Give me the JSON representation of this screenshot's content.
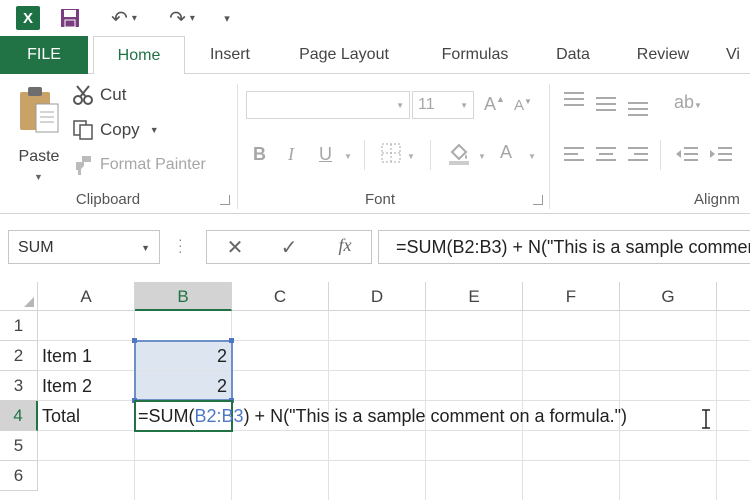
{
  "quick_access": {
    "app_logo": "X",
    "icons": [
      "excel-icon",
      "save-icon",
      "undo-icon",
      "redo-icon",
      "customize-qat-icon"
    ]
  },
  "ribbon_tabs": [
    "FILE",
    "Home",
    "Insert",
    "Page Layout",
    "Formulas",
    "Data",
    "Review",
    "Vi"
  ],
  "active_tab": "Home",
  "clipboard": {
    "label": "Clipboard",
    "paste": "Paste",
    "cut": "Cut",
    "copy": "Copy",
    "format_painter": "Format Painter"
  },
  "font_group": {
    "label": "Font",
    "font_name": "",
    "font_size": "11",
    "bold": "B",
    "italic": "I",
    "underline": "U",
    "font_color": "A"
  },
  "alignment_group": {
    "label": "Alignm"
  },
  "formula_bar": {
    "name_box": "SUM",
    "function_symbol": "fx",
    "formula": "=SUM(B2:B3) + N(\"This is a sample comment on a formula.\")"
  },
  "grid": {
    "columns": [
      "A",
      "B",
      "C",
      "D",
      "E",
      "F",
      "G"
    ],
    "selected_column": "B",
    "rows": [
      "1",
      "2",
      "3",
      "4",
      "5",
      "6"
    ],
    "selected_row": "4",
    "cells": {
      "A2": "Item 1",
      "B2": "2",
      "A3": "Item 2",
      "B3": "2",
      "A4": "Total"
    },
    "editing": {
      "cell": "B4",
      "prefix": "=SUM(",
      "ref": "B2:B3",
      "suffix": ") + N(\"This is a sample comment on a formula.\")"
    }
  },
  "colors": {
    "excel_green": "#217346",
    "range_blue": "#4f78c4",
    "range_fill": "#dde5f1"
  }
}
